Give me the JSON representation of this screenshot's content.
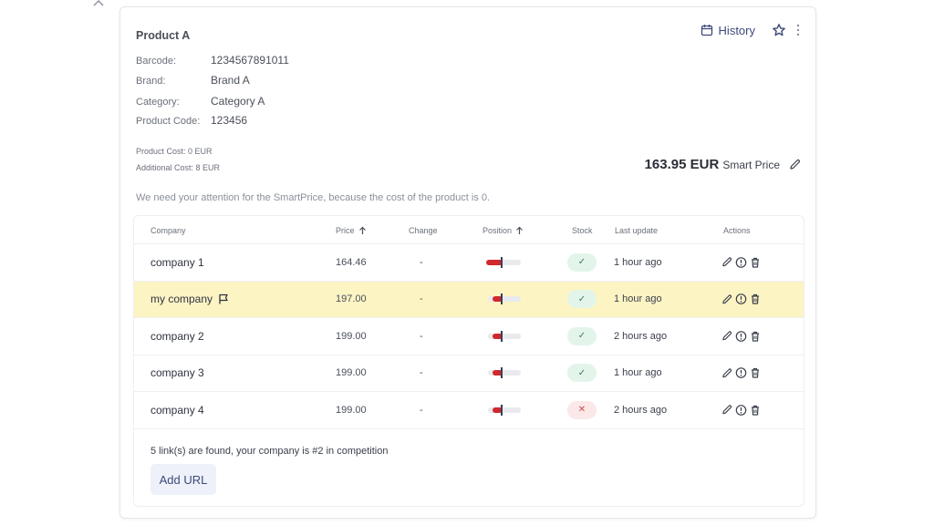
{
  "product": {
    "title": "Product A",
    "fields": [
      {
        "label": "Barcode:",
        "value": "1234567891011"
      },
      {
        "label": "Brand:",
        "value": "Brand A"
      },
      {
        "label": "Category:",
        "value": "Category A"
      },
      {
        "label": "Product Code:",
        "value": "123456"
      }
    ],
    "product_cost": "Product Cost: 0 EUR",
    "additional_cost": "Additional Cost: 8 EUR"
  },
  "header": {
    "history_label": "History",
    "icons": {
      "history": "calendar-icon",
      "favorite": "star-icon",
      "more": "kebab-menu-icon"
    }
  },
  "smart_price": {
    "amount": "163.95 EUR",
    "label": "Smart Price"
  },
  "attention_message": "We need your attention for the SmartPrice, because the cost of the product is 0.",
  "table": {
    "columns": {
      "company": "Company",
      "price": "Price",
      "change": "Change",
      "position": "Position",
      "stock": "Stock",
      "last_update": "Last update",
      "actions": "Actions"
    },
    "rows": [
      {
        "company": "company 1",
        "price": "164.46",
        "change": "-",
        "position_fill": 0.5,
        "in_stock": true,
        "stock_symbol": "✓",
        "last_update": "1 hour ago",
        "mine": false
      },
      {
        "company": "my company",
        "price": "197.00",
        "change": "-",
        "position_fill": 0.3,
        "in_stock": true,
        "stock_symbol": "✓",
        "last_update": "1 hour ago",
        "mine": true
      },
      {
        "company": "company 2",
        "price": "199.00",
        "change": "-",
        "position_fill": 0.3,
        "in_stock": true,
        "stock_symbol": "✓",
        "last_update": "2 hours ago",
        "mine": false
      },
      {
        "company": "company 3",
        "price": "199.00",
        "change": "-",
        "position_fill": 0.3,
        "in_stock": true,
        "stock_symbol": "✓",
        "last_update": "1 hour ago",
        "mine": false
      },
      {
        "company": "company 4",
        "price": "199.00",
        "change": "-",
        "position_fill": 0.3,
        "in_stock": false,
        "stock_symbol": "✕",
        "last_update": "2 hours ago",
        "mine": false
      }
    ],
    "summary": "5 link(s) are found, your company is #2 in competition",
    "add_url_label": "Add URL"
  },
  "colors": {
    "accent": "#3d4a7a",
    "highlight_row": "#fdf4c4",
    "position_bar": "#d0282c",
    "in_stock_bg": "#e3f5ea",
    "out_of_stock_bg": "#fbe8e8"
  }
}
